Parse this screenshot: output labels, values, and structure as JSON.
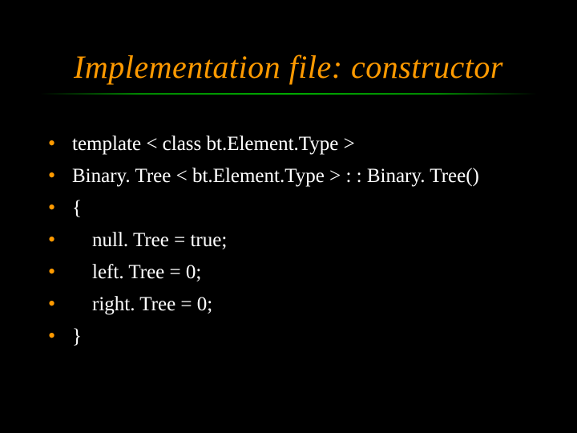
{
  "title": "Implementation file: constructor",
  "bullet_glyph": "•",
  "lines": [
    "template < class bt.Element.Type >",
    "Binary. Tree < bt.Element.Type > : : Binary. Tree()",
    "{",
    "    null. Tree = true;",
    "    left. Tree = 0;",
    "    right. Tree = 0;",
    "}"
  ]
}
